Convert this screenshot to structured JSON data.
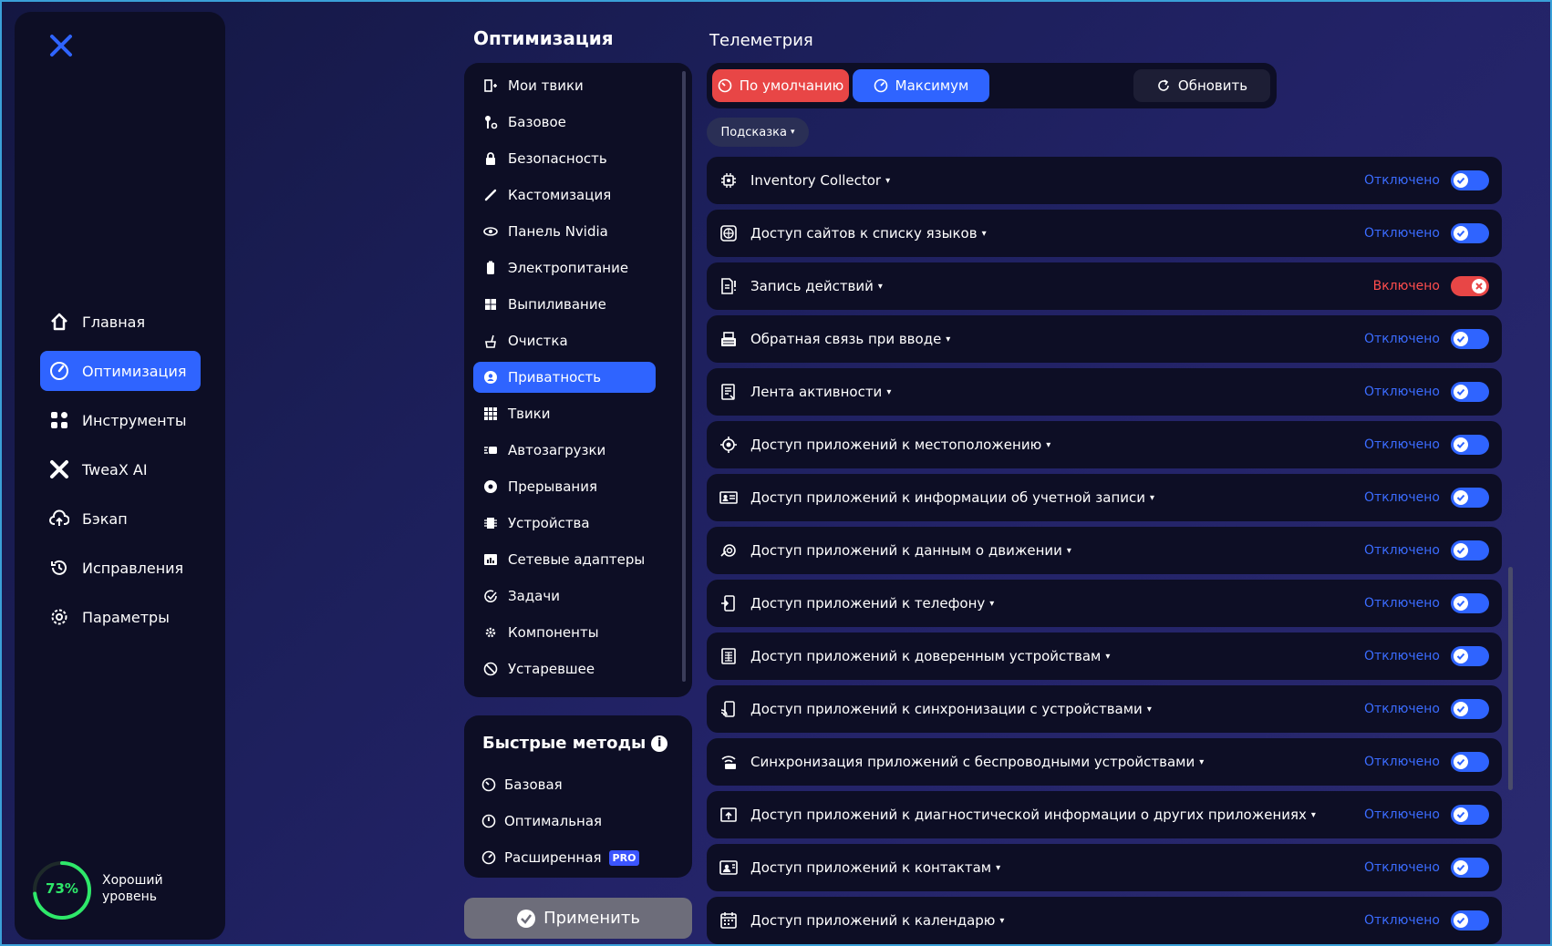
{
  "colors": {
    "accent": "#2f64ff",
    "danger": "#e84646",
    "panel": "#0d0e25",
    "good": "#2ee86a"
  },
  "sidebar": {
    "items": [
      {
        "label": "Главная",
        "icon": "home-icon"
      },
      {
        "label": "Оптимизация",
        "icon": "gauge-icon",
        "active": true
      },
      {
        "label": "Инструменты",
        "icon": "grid-icon"
      },
      {
        "label": "TweaX AI",
        "icon": "tweax-icon"
      },
      {
        "label": "Бэкап",
        "icon": "cloud-upload-icon"
      },
      {
        "label": "Исправления",
        "icon": "history-icon"
      },
      {
        "label": "Параметры",
        "icon": "gear-icon"
      }
    ],
    "score": {
      "value": "73%",
      "fraction": 0.73,
      "label": "Хороший уровень"
    }
  },
  "optimization": {
    "title": "Оптимизация",
    "items": [
      {
        "label": "Мои твики",
        "icon": "my-tweaks-icon"
      },
      {
        "label": "Базовое",
        "icon": "wrench-icon"
      },
      {
        "label": "Безопасность",
        "icon": "lock-icon"
      },
      {
        "label": "Кастомизация",
        "icon": "brush-icon"
      },
      {
        "label": "Панель Nvidia",
        "icon": "nvidia-icon"
      },
      {
        "label": "Электропитание",
        "icon": "battery-icon"
      },
      {
        "label": "Выпиливание",
        "icon": "windows-icon"
      },
      {
        "label": "Очистка",
        "icon": "cleanup-icon"
      },
      {
        "label": "Приватность",
        "icon": "privacy-icon",
        "active": true
      },
      {
        "label": "Твики",
        "icon": "tweaks-grid-icon"
      },
      {
        "label": "Автозагрузки",
        "icon": "autostart-icon"
      },
      {
        "label": "Прерывания",
        "icon": "interrupts-icon"
      },
      {
        "label": "Устройства",
        "icon": "devices-icon"
      },
      {
        "label": "Сетевые адаптеры",
        "icon": "network-adapter-icon"
      },
      {
        "label": "Задачи",
        "icon": "tasks-icon"
      },
      {
        "label": "Компоненты",
        "icon": "components-icon"
      },
      {
        "label": "Устаревшее",
        "icon": "deprecated-icon"
      }
    ]
  },
  "quick": {
    "title": "Быстрые методы",
    "info": "i",
    "items": [
      {
        "label": "Базовая",
        "icon": "speed-low-icon"
      },
      {
        "label": "Оптимальная",
        "icon": "speed-mid-icon"
      },
      {
        "label": "Расширенная",
        "icon": "speed-high-icon",
        "badge": "PRO"
      }
    ]
  },
  "apply": {
    "label": "Применить"
  },
  "telemetry": {
    "title": "Телеметрия",
    "presets": {
      "default": "По умолчанию",
      "max": "Максимум",
      "refresh": "Обновить"
    },
    "hint": "Подсказка",
    "rows": [
      {
        "label": "Inventory Collector",
        "status": "Отключено",
        "on": false,
        "icon": "chip-icon"
      },
      {
        "label": "Доступ сайтов к списку языков",
        "status": "Отключено",
        "on": false,
        "icon": "globe-icon"
      },
      {
        "label": "Запись действий",
        "status": "Включено",
        "on": true,
        "icon": "record-file-icon"
      },
      {
        "label": "Обратная связь при вводе",
        "status": "Отключено",
        "on": false,
        "icon": "keyboard-icon"
      },
      {
        "label": "Лента активности",
        "status": "Отключено",
        "on": false,
        "icon": "activity-feed-icon"
      },
      {
        "label": "Доступ приложений к местоположению",
        "status": "Отключено",
        "on": false,
        "icon": "location-icon"
      },
      {
        "label": "Доступ приложений к информации об учетной записи",
        "status": "Отключено",
        "on": false,
        "icon": "account-card-icon"
      },
      {
        "label": "Доступ приложений к данным о движении",
        "status": "Отключено",
        "on": false,
        "icon": "motion-icon"
      },
      {
        "label": "Доступ приложений к телефону",
        "status": "Отключено",
        "on": false,
        "icon": "phone-icon"
      },
      {
        "label": "Доступ приложений к доверенным устройствам",
        "status": "Отключено",
        "on": false,
        "icon": "trusted-device-icon"
      },
      {
        "label": "Доступ приложений к синхронизации с устройствами",
        "status": "Отключено",
        "on": false,
        "icon": "device-sync-icon"
      },
      {
        "label": "Синхронизация приложений с беспроводными устройствами",
        "status": "Отключено",
        "on": false,
        "icon": "wireless-sync-icon"
      },
      {
        "label": "Доступ приложений к диагностической информации о других приложениях",
        "status": "Отключено",
        "on": false,
        "icon": "diagnostics-icon"
      },
      {
        "label": "Доступ приложений к контактам",
        "status": "Отключено",
        "on": false,
        "icon": "contacts-icon"
      },
      {
        "label": "Доступ приложений к календарю",
        "status": "Отключено",
        "on": false,
        "icon": "calendar-icon"
      }
    ]
  }
}
